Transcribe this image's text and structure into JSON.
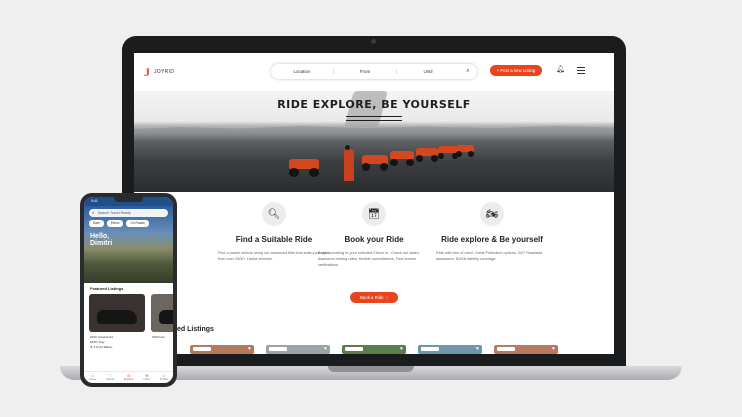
{
  "web": {
    "logo_text": "JOYRID",
    "search": {
      "location": "Location",
      "from": "From",
      "until": "Until"
    },
    "listing_button": "+ Post a new Listing",
    "hero_title": "RIDE EXPLORE, BE YOURSELF",
    "features": [
      {
        "title": "Find a Suitable Ride",
        "desc": "Find a power vehicle using our advanced filter that suits your style from over 2500+ Listed vehicles.",
        "icon": "atv-search-icon"
      },
      {
        "title": "Book your Ride",
        "desc": "Book according to your selected Check in - Check out dates, Awesome renting rates, flexible cancellations, Fast license verifications.",
        "icon": "calendar-icon"
      },
      {
        "title": "Ride explore & Be yourself",
        "desc": "Ride with free of mind, Great Protection options, 24/7 Roadside assistance, $100k liability coverage.",
        "icon": "rider-icon"
      }
    ],
    "book_button": "Book a Ride",
    "featured_heading": "ured Listings"
  },
  "phone": {
    "time": "9:41",
    "search_placeholder": "Search Travel Ready",
    "chips": [
      "Date",
      "Filters",
      "On Roads"
    ],
    "hello": "Hello,",
    "name": "Dimitri",
    "featured_heading": "Featured Listings",
    "card1": {
      "name": "2020 Yamaha R1",
      "price": "$199 / Day",
      "rating": "★ 4.9 (44 Rides)"
    },
    "card2": {
      "name": "2020 Hon"
    },
    "tabs": [
      {
        "label": "Home",
        "icon": "⌂",
        "active": false
      },
      {
        "label": "Saved",
        "icon": "♡",
        "active": false
      },
      {
        "label": "Explore",
        "icon": "◎",
        "active": true
      },
      {
        "label": "Inbox",
        "icon": "✉",
        "active": false
      },
      {
        "label": "Profile",
        "icon": "☺",
        "active": false
      }
    ]
  },
  "colors": {
    "accent": "#e8451f",
    "phone_header": "#1d4f8c"
  }
}
